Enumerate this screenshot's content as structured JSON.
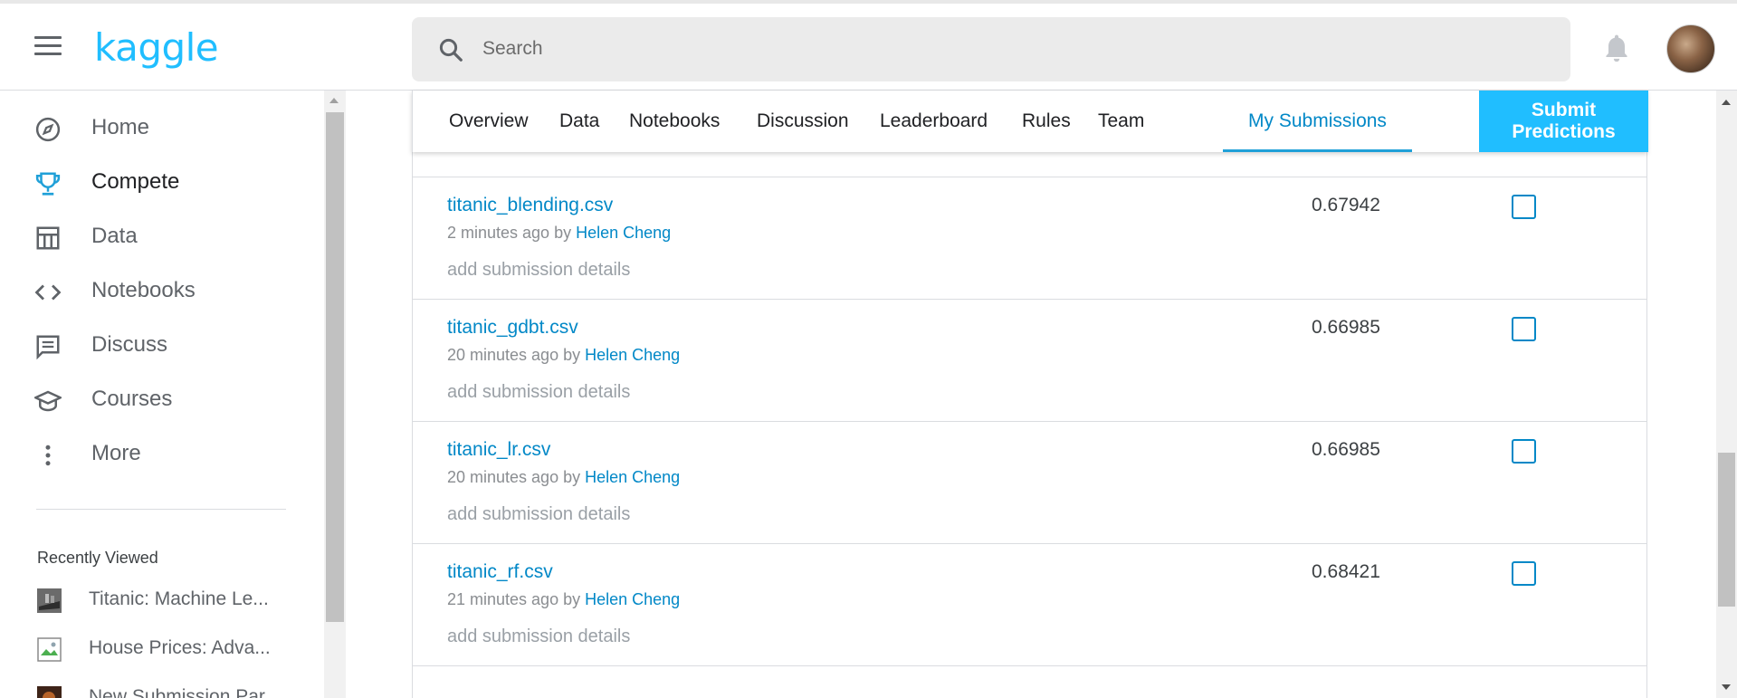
{
  "header": {
    "logo": "kaggle",
    "search_placeholder": "Search",
    "icons": {
      "menu": "hamburger-icon",
      "search": "search-icon",
      "notifications": "bell-icon"
    }
  },
  "sidebar": {
    "items": [
      {
        "label": "Home",
        "icon": "compass-icon"
      },
      {
        "label": "Compete",
        "icon": "trophy-icon",
        "active": true
      },
      {
        "label": "Data",
        "icon": "table-icon"
      },
      {
        "label": "Notebooks",
        "icon": "code-icon"
      },
      {
        "label": "Discuss",
        "icon": "comment-icon"
      },
      {
        "label": "Courses",
        "icon": "graduation-cap-icon"
      },
      {
        "label": "More",
        "icon": "more-vertical-icon"
      }
    ],
    "recently_viewed_title": "Recently Viewed",
    "recently_viewed": [
      {
        "label": "Titanic: Machine Le..."
      },
      {
        "label": "House Prices: Adva..."
      },
      {
        "label": "New Submission Par..."
      }
    ]
  },
  "tabs": {
    "items": [
      "Overview",
      "Data",
      "Notebooks",
      "Discussion",
      "Leaderboard",
      "Rules",
      "Team"
    ],
    "my_submissions": "My Submissions",
    "submit_predictions": "Submit Predictions"
  },
  "submissions": [
    {
      "file": "titanic_blending.csv",
      "time": "2 minutes ago by",
      "author": "Helen Cheng",
      "details": "add submission details",
      "score": "0.67942",
      "selected": false
    },
    {
      "file": "titanic_gdbt.csv",
      "time": "20 minutes ago by",
      "author": "Helen Cheng",
      "details": "add submission details",
      "score": "0.66985",
      "selected": false
    },
    {
      "file": "titanic_lr.csv",
      "time": "20 minutes ago by",
      "author": "Helen Cheng",
      "details": "add submission details",
      "score": "0.66985",
      "selected": false
    },
    {
      "file": "titanic_rf.csv",
      "time": "21 minutes ago by",
      "author": "Helen Cheng",
      "details": "add submission details",
      "score": "0.68421",
      "selected": false
    }
  ],
  "colors": {
    "brand": "#20beff",
    "link": "#0288c7"
  }
}
